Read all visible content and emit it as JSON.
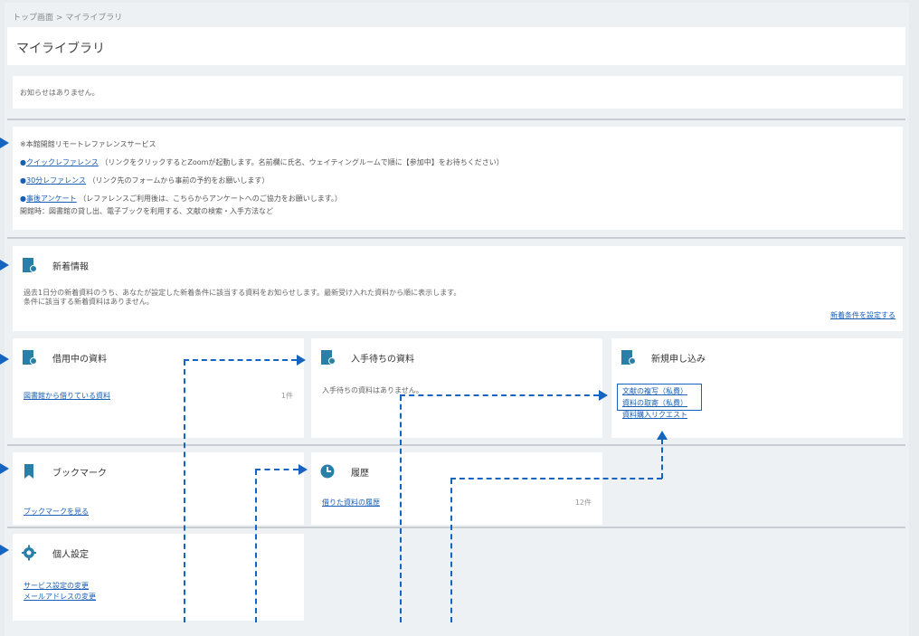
{
  "breadcrumb": "トップ画面 > マイライブラリ",
  "page_title": "マイライブラリ",
  "notice": "お知らせはありません。",
  "reference": {
    "heading": "※本館開館リモートレファレンスサービス",
    "items": [
      {
        "link": "クイックレファレンス",
        "note": "（リンクをクリックするとZoomが起動します。名前欄に氏名、ウェイティングルームで順に【参加中】をお待ちください）"
      },
      {
        "link": "30分レファレンス",
        "note": "（リンク先のフォームから事前の予約をお願いします）"
      },
      {
        "link": "事後アンケート",
        "note": "（レファレンスご利用後は、こちらからアンケートへのご協力をお願いします。）"
      }
    ],
    "footnote": "開館時：図書館の貸し出、電子ブックを利用する、文献の検索・入手方法など"
  },
  "new_arrivals": {
    "title": "新着情報",
    "desc1": "過去1日分の新着資料のうち、あなたが設定した新着条件に該当する資料をお知らせします。最新受け入れた資料から順に表示します。",
    "desc2": "条件に該当する新着資料はありません。",
    "link": "新着条件を設定する"
  },
  "cards": {
    "borrowing": {
      "title": "借用中の資料",
      "link": "図書館から借りている資料",
      "count": "1件"
    },
    "waiting": {
      "title": "入手待ちの資料",
      "desc": "入手待ちの資料はありません。"
    },
    "new_request": {
      "title": "新規申し込み",
      "links": [
        "文献の複写（私費）",
        "資料の取寄（私費）",
        "資料購入リクエスト"
      ]
    },
    "bookmark": {
      "title": "ブックマーク",
      "link": "ブックマークを見る"
    },
    "history": {
      "title": "履歴",
      "link": "借りた資料の履歴",
      "count": "12件"
    },
    "settings": {
      "title": "個人設定",
      "links": [
        "サービス設定の変更",
        "メールアドレスの変更"
      ]
    }
  },
  "colors": {
    "accent": "#1565c0",
    "icon": "#2a7fa8",
    "link": "#1a5fb4"
  },
  "icons": [
    "book-icon",
    "book-icon",
    "book-icon",
    "book-icon",
    "bookmark-icon",
    "clock-icon",
    "gear-icon"
  ]
}
